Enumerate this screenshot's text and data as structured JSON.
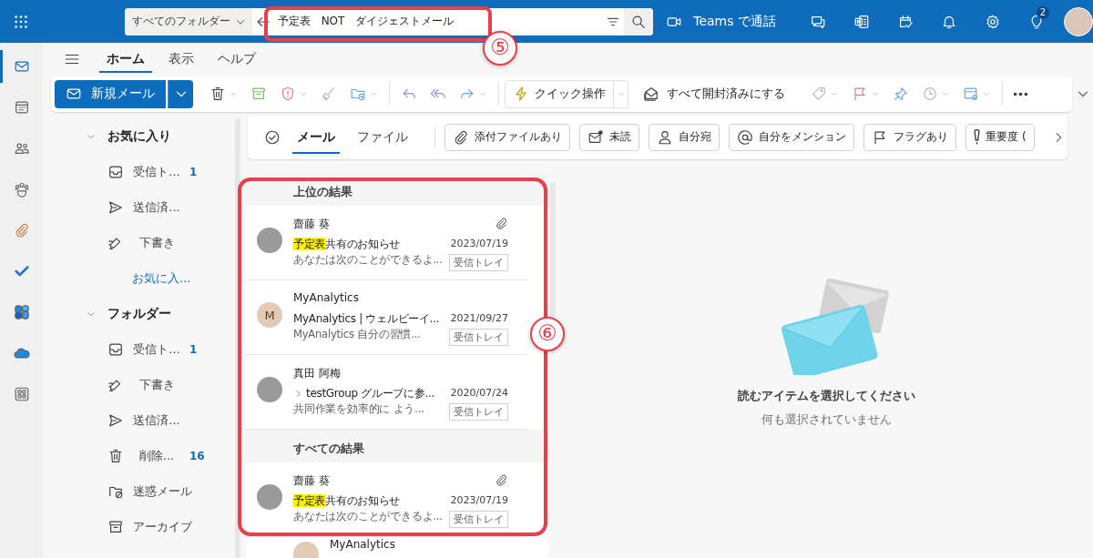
{
  "top_bar": {
    "search": {
      "scope": "すべてのフォルダー",
      "query": "予定表　NOT　ダイジェストメール"
    },
    "teams_call": "Teams で通話",
    "tips_badge": "2"
  },
  "app_rail": [
    {
      "kind": "mail",
      "selected": true
    },
    {
      "kind": "calendar",
      "selected": false
    },
    {
      "kind": "people",
      "selected": false
    },
    {
      "kind": "groups",
      "selected": false
    },
    {
      "kind": "files",
      "selected": false
    },
    {
      "kind": "todo",
      "selected": false
    },
    {
      "kind": "m365",
      "selected": false
    },
    {
      "kind": "cloud",
      "selected": false
    },
    {
      "kind": "apps",
      "selected": false
    }
  ],
  "ribbon_tabs": [
    {
      "label": "ホーム",
      "selected": true
    },
    {
      "label": "表示",
      "selected": false
    },
    {
      "label": "ヘルプ",
      "selected": false
    }
  ],
  "toolbar": {
    "new_mail": "新規メール",
    "quick_steps": "クイック操作",
    "mark_all_read": "すべて開封済みにする"
  },
  "folder_pane": {
    "sections": [
      {
        "title": "お気に入り",
        "expanded": true,
        "items": [
          {
            "kind": "inbox",
            "label": "受信ト...",
            "count": "1"
          },
          {
            "kind": "sent",
            "label": "送信済..."
          },
          {
            "kind": "drafts",
            "label": "下書き"
          }
        ],
        "link": "お気に入..."
      },
      {
        "title": "フォルダー",
        "expanded": true,
        "items": [
          {
            "kind": "inbox",
            "label": "受信ト...",
            "count": "1"
          },
          {
            "kind": "drafts",
            "label": "下書き"
          },
          {
            "kind": "sent",
            "label": "送信済..."
          },
          {
            "kind": "deleted",
            "label": "削除...",
            "count": "16"
          },
          {
            "kind": "junk",
            "label": "迷惑メール"
          },
          {
            "kind": "archive",
            "label": "アーカイブ"
          }
        ]
      }
    ]
  },
  "filter_bar": {
    "tabs": [
      {
        "label": "メール",
        "selected": true
      },
      {
        "label": "ファイル",
        "selected": false
      }
    ],
    "chips": [
      {
        "kind": "attachment",
        "label": "添付ファイルあり"
      },
      {
        "kind": "unread",
        "label": "未読"
      },
      {
        "kind": "to_me",
        "label": "自分宛"
      },
      {
        "kind": "mention",
        "label": "自分をメンション"
      },
      {
        "kind": "flagged",
        "label": "フラグあり"
      },
      {
        "kind": "importance",
        "label": "重要度 ("
      }
    ]
  },
  "message_list": {
    "groups": [
      {
        "title": "上位の結果",
        "messages": [
          {
            "avatar": {
              "kind": "photo"
            },
            "sender": "齋藤 葵",
            "subject": [
              {
                "text": "予定表",
                "highlighted": true
              },
              {
                "text": "共有のお知らせ",
                "highlighted": false
              }
            ],
            "preview": "あなたは次のことができるよ...",
            "date": "2023/07/19",
            "folder": "受信トレイ",
            "has_attachment": true,
            "thread_chevron": false
          },
          {
            "avatar": {
              "kind": "initial",
              "initial": "M"
            },
            "sender": "MyAnalytics",
            "subject": [
              {
                "text": "MyAnalytics | ウェルビーイ...",
                "highlighted": false
              }
            ],
            "preview": "MyAnalytics 自分の習慣...",
            "date": "2021/09/27",
            "folder": "受信トレイ",
            "has_attachment": false,
            "thread_chevron": false
          },
          {
            "avatar": {
              "kind": "photo"
            },
            "sender": "真田 阿梅",
            "subject": [
              {
                "text": "testGroup グループに参...",
                "highlighted": false
              }
            ],
            "preview": "共同作業を効率的に よう...",
            "date": "2020/07/24",
            "folder": "受信トレイ",
            "has_attachment": false,
            "thread_chevron": true
          }
        ]
      },
      {
        "title": "すべての結果",
        "messages": [
          {
            "avatar": {
              "kind": "photo"
            },
            "sender": "齋藤 葵",
            "subject": [
              {
                "text": "予定表",
                "highlighted": true
              },
              {
                "text": "共有のお知らせ",
                "highlighted": false
              }
            ],
            "preview": "あなたは次のことができるよ...",
            "date": "2023/07/19",
            "folder": "受信トレイ",
            "has_attachment": true,
            "thread_chevron": false
          },
          {
            "avatar": {
              "kind": "initial"
            },
            "sender": "MyAnalytics"
          }
        ]
      }
    ]
  },
  "reading_pane": {
    "title": "読むアイテムを選択してください",
    "subtitle": "何も選択されていません"
  },
  "annotations": [
    {
      "label": "⑤"
    },
    {
      "label": "⑥"
    }
  ]
}
